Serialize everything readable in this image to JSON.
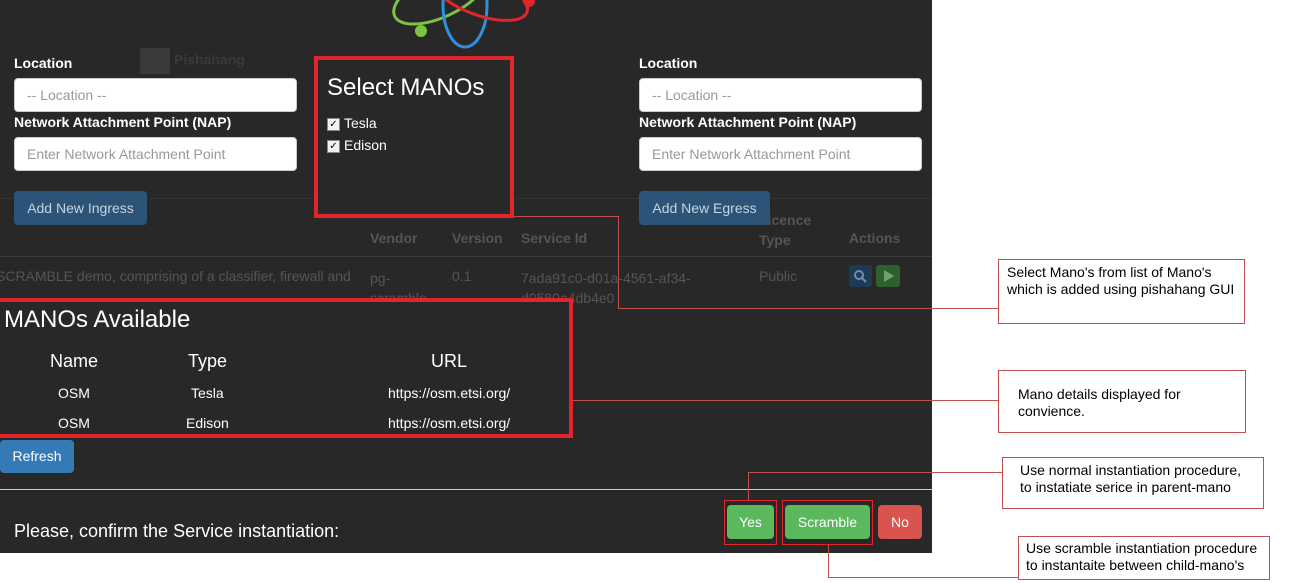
{
  "ingress": {
    "location_label": "Location",
    "location_placeholder": "-- Location --",
    "nap_label": "Network Attachment Point (NAP)",
    "nap_placeholder": "Enter Network Attachment Point",
    "add_button": "Add New Ingress"
  },
  "egress": {
    "location_label": "Location",
    "location_placeholder": "-- Location --",
    "nap_label": "Network Attachment Point (NAP)",
    "nap_placeholder": "Enter Network Attachment Point",
    "add_button": "Add New Egress"
  },
  "logo_text": "Pishahang",
  "select_manos": {
    "title": "Select MANOs",
    "options": [
      {
        "label": "Tesla",
        "checked": true
      },
      {
        "label": "Edison",
        "checked": true
      }
    ]
  },
  "background_table": {
    "headers": [
      "Vendor",
      "Version",
      "Service Id",
      "Licence Type",
      "Actions"
    ],
    "header_licence_line1": "Licence",
    "header_licence_line2": "Type",
    "row": {
      "description": "SCRAMBLE demo, comprising of a classifier, firewall and",
      "vendor_line1": "pg-",
      "vendor_line2": "scramble",
      "version": "0.1",
      "service_id_line1": "7ada91c0-d01a-4561-af34-",
      "service_id_line2": "d0580a4db4e0",
      "licence": "Public"
    }
  },
  "manos_available": {
    "title": "MANOs Available",
    "headers": [
      "Name",
      "Type",
      "URL"
    ],
    "rows": [
      {
        "name": "OSM",
        "type": "Tesla",
        "url": "https://osm.etsi.org/"
      },
      {
        "name": "OSM",
        "type": "Edison",
        "url": "https://osm.etsi.org/"
      }
    ]
  },
  "refresh_button": "Refresh",
  "confirm": {
    "text": "Please, confirm the Service instantiation:",
    "yes": "Yes",
    "scramble": "Scramble",
    "no": "No"
  },
  "callouts": {
    "select": "Select Mano's from list of Mano's which is added using pishahang GUI",
    "details": "Mano details displayed for convience.",
    "normal": "Use normal instantiation procedure, to instatiate serice in parent-mano",
    "scramble": "Use scramble instantiation procedure to instantaite between child-mano's"
  },
  "colors": {
    "dark_bg": "#282828",
    "highlight_red": "#e0262a",
    "primary_blue": "#337ab7",
    "success_green": "#5cb85c",
    "danger_red": "#d9534f"
  }
}
